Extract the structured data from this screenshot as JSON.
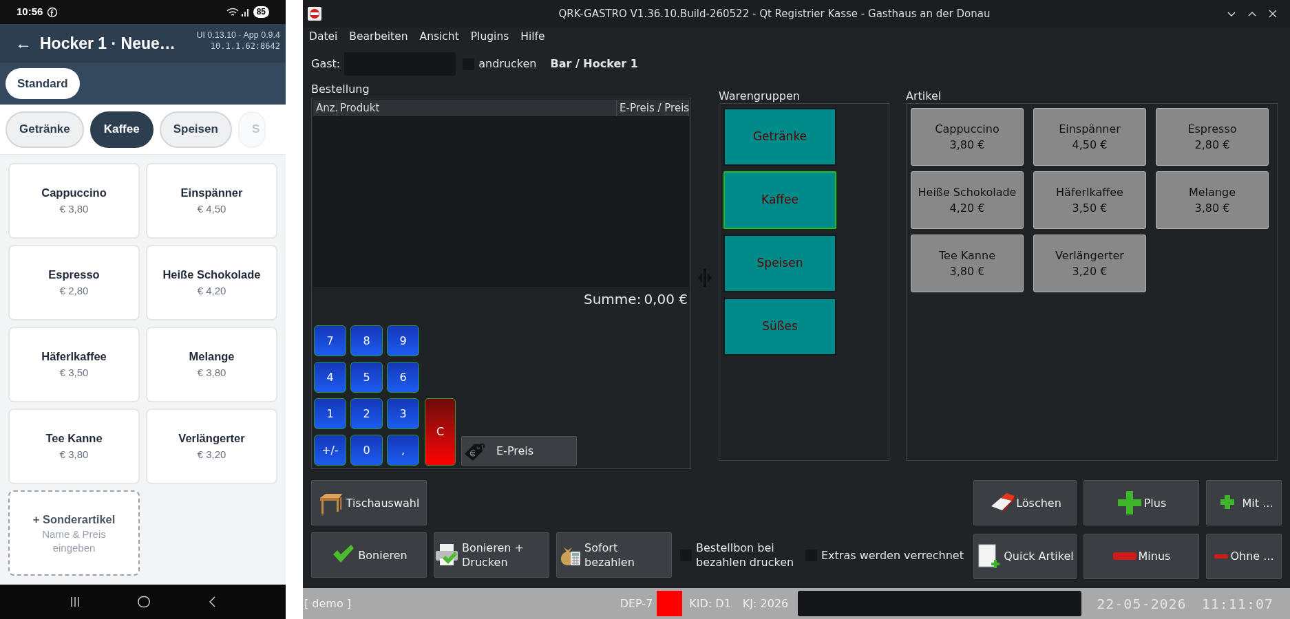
{
  "phone": {
    "status_bar": {
      "time": "10:56",
      "battery": "85"
    },
    "header": {
      "back": "←",
      "title": "Hocker 1 · Neue…",
      "version": "UI 0.13.10 · App 0.9.4",
      "address": "10.1.1.62:8642"
    },
    "chips": [
      {
        "label": "Standard",
        "selected": true
      }
    ],
    "categories": [
      {
        "label": "Getränke",
        "selected": false
      },
      {
        "label": "Kaffee",
        "selected": true
      },
      {
        "label": "Speisen",
        "selected": false
      },
      {
        "label": "S",
        "selected": false
      }
    ],
    "products": [
      {
        "name": "Cappuccino",
        "price": "€ 3,80"
      },
      {
        "name": "Einspänner",
        "price": "€ 4,50"
      },
      {
        "name": "Espresso",
        "price": "€ 2,80"
      },
      {
        "name": "Heiße Schokolade",
        "price": "€ 4,20"
      },
      {
        "name": "Häferlkaffee",
        "price": "€ 3,50"
      },
      {
        "name": "Melange",
        "price": "€ 3,80"
      },
      {
        "name": "Tee Kanne",
        "price": "€ 3,80"
      },
      {
        "name": "Verlängerter",
        "price": "€ 3,20"
      }
    ],
    "special": {
      "title": "+ Sonderartikel",
      "hint": "Name & Preis eingeben"
    }
  },
  "qrk": {
    "window": {
      "title": "QRK-GASTRO V1.36.10.Build-260522 - Qt Registrier Kasse - Gasthaus an der Donau"
    },
    "menu": [
      "Datei",
      "Bearbeiten",
      "Ansicht",
      "Plugins",
      "Hilfe"
    ],
    "guest": {
      "label": "Gast:",
      "print_label": "andrucken",
      "print_checked": false,
      "table": "Bar / Hocker 1"
    },
    "order": {
      "label": "Bestellung",
      "columns": [
        "Anz.",
        "Produkt",
        "E-Preis / Preis"
      ],
      "sum_label": "Summe:",
      "sum_value": "0,00 €"
    },
    "numpad": {
      "keys": [
        "7",
        "8",
        "9",
        "4",
        "5",
        "6",
        "1",
        "2",
        "3",
        "+/-",
        "0",
        ","
      ],
      "clear": "C",
      "unit_price": "E-Preis"
    },
    "groups": {
      "label": "Warengruppen",
      "items": [
        {
          "label": "Getränke",
          "selected": false
        },
        {
          "label": "Kaffee",
          "selected": true
        },
        {
          "label": "Speisen",
          "selected": false
        },
        {
          "label": "Süßes",
          "selected": false
        }
      ]
    },
    "articles": {
      "label": "Artikel",
      "items": [
        {
          "name": "Cappuccino",
          "price": "3,80 €"
        },
        {
          "name": "Einspänner",
          "price": "4,50 €"
        },
        {
          "name": "Espresso",
          "price": "2,80 €"
        },
        {
          "name": "Heiße Schokolade",
          "price": "4,20 €"
        },
        {
          "name": "Häferlkaffee",
          "price": "3,50 €"
        },
        {
          "name": "Melange",
          "price": "3,80 €"
        },
        {
          "name": "Tee Kanne",
          "price": "3,80 €"
        },
        {
          "name": "Verlängerter",
          "price": "3,20 €"
        }
      ]
    },
    "table_button": {
      "label": "Tischauswahl"
    },
    "actions": [
      {
        "label": "Bonieren"
      },
      {
        "label": "Bonieren + Drucken"
      },
      {
        "label": "Sofort bezahlen"
      }
    ],
    "options": [
      {
        "label": "Bestellbon bei bezahlen drucken",
        "checked": false
      },
      {
        "label": "Extras werden verrechnet",
        "checked": false
      }
    ],
    "edit_buttons": [
      {
        "label": "Löschen"
      },
      {
        "label": "Plus"
      },
      {
        "label": "Mit ..."
      },
      {
        "label": "Quick Artikel"
      },
      {
        "label": "Minus"
      },
      {
        "label": "Ohne ..."
      }
    ],
    "status_bar": {
      "mode": "[ demo ]",
      "dep": "DEP-7",
      "kid": "KID: D1",
      "kj": "KJ: 2026",
      "date": "22-05-2026",
      "time": "11:11:07"
    }
  }
}
